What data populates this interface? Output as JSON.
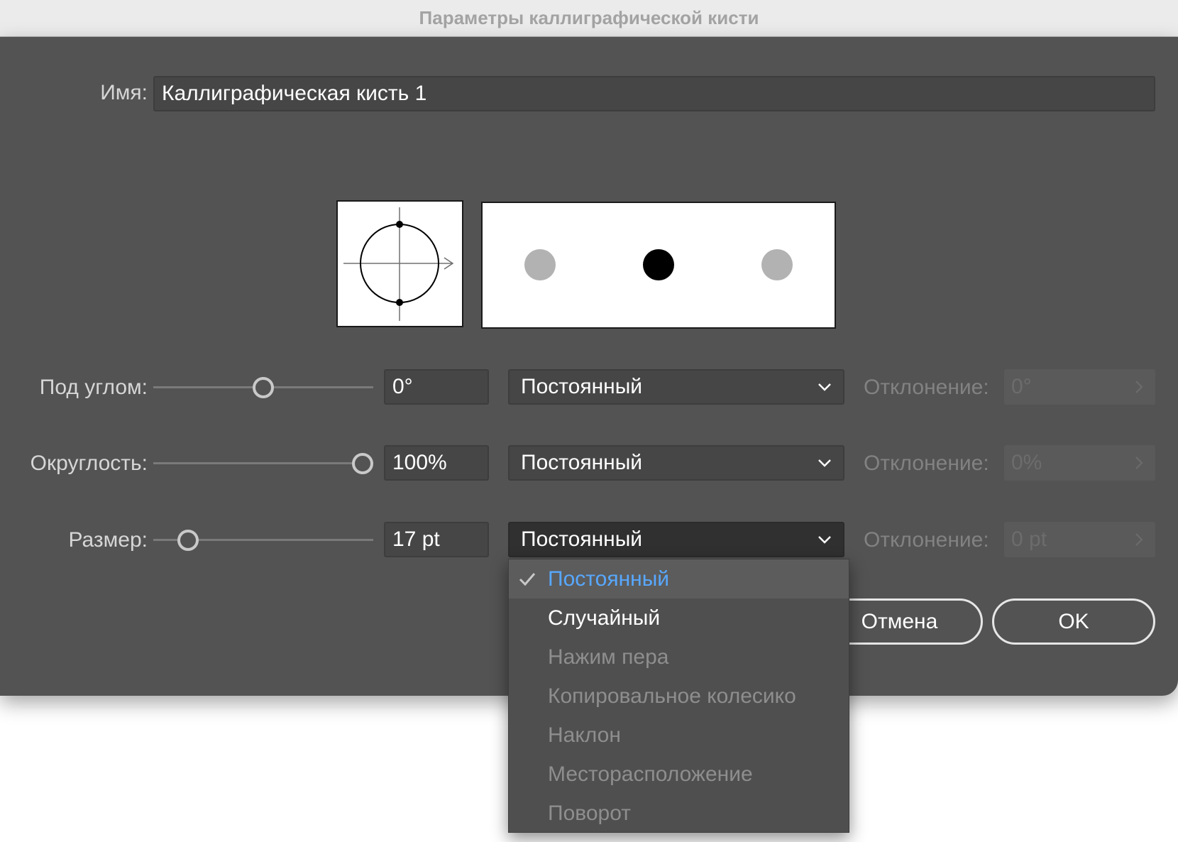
{
  "window": {
    "title": "Параметры каллиграфической кисти"
  },
  "name_field": {
    "label": "Имя:",
    "value": "Каллиграфическая кисть 1"
  },
  "controls": {
    "angle": {
      "label": "Под углом:",
      "value": "0°",
      "mode": "Постоянный",
      "variation_label": "Отклонение:",
      "variation_value": "0°",
      "slider_fraction": 0.5
    },
    "roundness": {
      "label": "Округлость:",
      "value": "100%",
      "mode": "Постоянный",
      "variation_label": "Отклонение:",
      "variation_value": "0%",
      "slider_fraction": 1.0
    },
    "size": {
      "label": "Размер:",
      "value": "17 pt",
      "mode": "Постоянный",
      "variation_label": "Отклонение:",
      "variation_value": "0 pt",
      "slider_fraction": 0.12
    }
  },
  "buttons": {
    "cancel": "Отмена",
    "ok": "OK"
  },
  "dropdown": {
    "items": [
      {
        "label": "Постоянный",
        "state": "selected"
      },
      {
        "label": "Случайный",
        "state": "enabled"
      },
      {
        "label": "Нажим пера",
        "state": "disabled"
      },
      {
        "label": "Копировальное колесико",
        "state": "disabled"
      },
      {
        "label": "Наклон",
        "state": "disabled"
      },
      {
        "label": "Месторасположение",
        "state": "disabled"
      },
      {
        "label": "Поворот",
        "state": "disabled"
      }
    ]
  },
  "icons": {
    "combo_chevron": "chevron-down-icon",
    "variation_arrow": "chevron-right-icon",
    "selected_mark": "checkmark-icon"
  },
  "colors": {
    "dialog_bg": "#535353",
    "field_bg": "#464646",
    "selected_text": "#58a8ff"
  }
}
